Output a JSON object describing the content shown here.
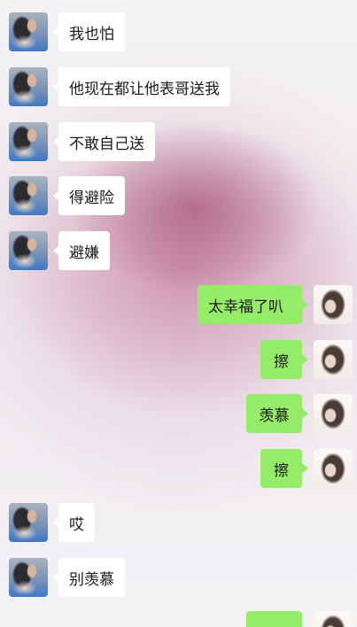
{
  "messages": [
    {
      "side": "left",
      "text": "我也怕"
    },
    {
      "side": "left",
      "text": "他现在都让他表哥送我"
    },
    {
      "side": "left",
      "text": "不敢自己送"
    },
    {
      "side": "left",
      "text": "得避险"
    },
    {
      "side": "left",
      "text": "避嫌"
    },
    {
      "side": "right",
      "text": "太幸福了叭"
    },
    {
      "side": "right",
      "text": "擦"
    },
    {
      "side": "right",
      "text": "羡慕"
    },
    {
      "side": "right",
      "text": "擦"
    },
    {
      "side": "left",
      "text": "哎"
    },
    {
      "side": "left",
      "text": "别羡慕"
    }
  ],
  "colors": {
    "incoming_bubble": "#ffffff",
    "outgoing_bubble": "#95ec69",
    "text": "#1b1b1b"
  }
}
